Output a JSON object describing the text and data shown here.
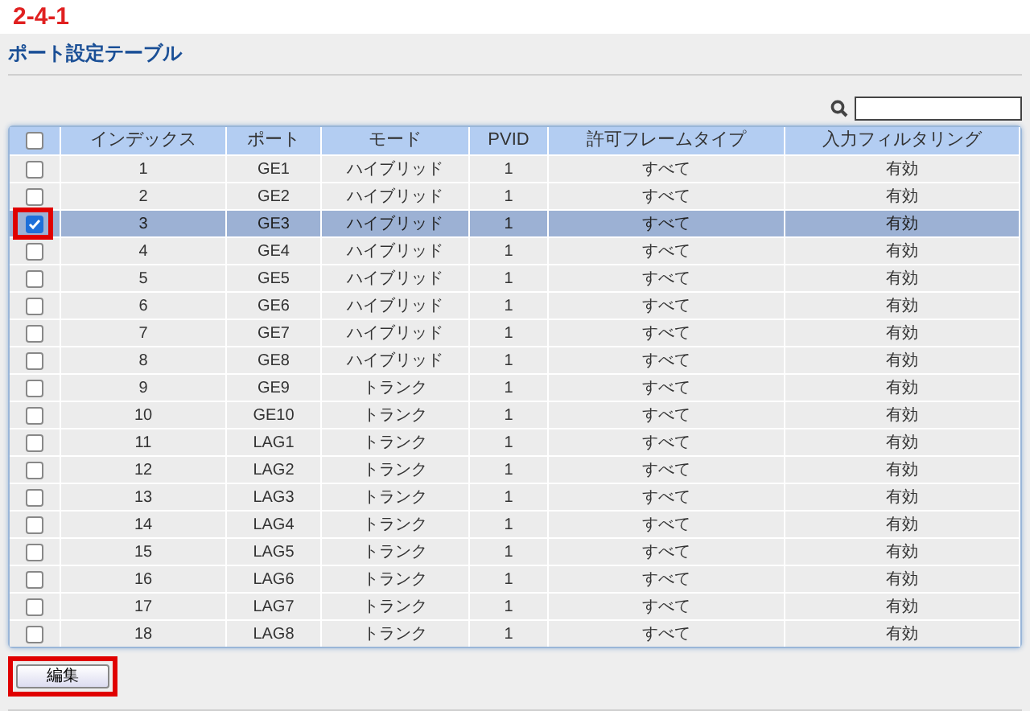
{
  "annotation": "2-4-1",
  "title": "ポート設定テーブル",
  "table": {
    "select_all": {
      "checked": false
    },
    "columns": [
      "インデックス",
      "ポート",
      "モード",
      "PVID",
      "許可フレームタイプ",
      "入力フィルタリング"
    ],
    "rows": [
      {
        "cells": [
          "1",
          "GE1",
          "ハイブリッド",
          "1",
          "すべて",
          "有効"
        ],
        "checked": false,
        "callout": false
      },
      {
        "cells": [
          "2",
          "GE2",
          "ハイブリッド",
          "1",
          "すべて",
          "有効"
        ],
        "checked": false,
        "callout": false
      },
      {
        "cells": [
          "3",
          "GE3",
          "ハイブリッド",
          "1",
          "すべて",
          "有効"
        ],
        "checked": true,
        "callout": true
      },
      {
        "cells": [
          "4",
          "GE4",
          "ハイブリッド",
          "1",
          "すべて",
          "有効"
        ],
        "checked": false,
        "callout": false
      },
      {
        "cells": [
          "5",
          "GE5",
          "ハイブリッド",
          "1",
          "すべて",
          "有効"
        ],
        "checked": false,
        "callout": false
      },
      {
        "cells": [
          "6",
          "GE6",
          "ハイブリッド",
          "1",
          "すべて",
          "有効"
        ],
        "checked": false,
        "callout": false
      },
      {
        "cells": [
          "7",
          "GE7",
          "ハイブリッド",
          "1",
          "すべて",
          "有効"
        ],
        "checked": false,
        "callout": false
      },
      {
        "cells": [
          "8",
          "GE8",
          "ハイブリッド",
          "1",
          "すべて",
          "有効"
        ],
        "checked": false,
        "callout": false
      },
      {
        "cells": [
          "9",
          "GE9",
          "トランク",
          "1",
          "すべて",
          "有効"
        ],
        "checked": false,
        "callout": false
      },
      {
        "cells": [
          "10",
          "GE10",
          "トランク",
          "1",
          "すべて",
          "有効"
        ],
        "checked": false,
        "callout": false
      },
      {
        "cells": [
          "11",
          "LAG1",
          "トランク",
          "1",
          "すべて",
          "有効"
        ],
        "checked": false,
        "callout": false
      },
      {
        "cells": [
          "12",
          "LAG2",
          "トランク",
          "1",
          "すべて",
          "有効"
        ],
        "checked": false,
        "callout": false
      },
      {
        "cells": [
          "13",
          "LAG3",
          "トランク",
          "1",
          "すべて",
          "有効"
        ],
        "checked": false,
        "callout": false
      },
      {
        "cells": [
          "14",
          "LAG4",
          "トランク",
          "1",
          "すべて",
          "有効"
        ],
        "checked": false,
        "callout": false
      },
      {
        "cells": [
          "15",
          "LAG5",
          "トランク",
          "1",
          "すべて",
          "有効"
        ],
        "checked": false,
        "callout": false
      },
      {
        "cells": [
          "16",
          "LAG6",
          "トランク",
          "1",
          "すべて",
          "有効"
        ],
        "checked": false,
        "callout": false
      },
      {
        "cells": [
          "17",
          "LAG7",
          "トランク",
          "1",
          "すべて",
          "有効"
        ],
        "checked": false,
        "callout": false
      },
      {
        "cells": [
          "18",
          "LAG8",
          "トランク",
          "1",
          "すべて",
          "有効"
        ],
        "checked": false,
        "callout": false
      }
    ]
  },
  "edit_button": {
    "label": "編集",
    "callout": true
  }
}
